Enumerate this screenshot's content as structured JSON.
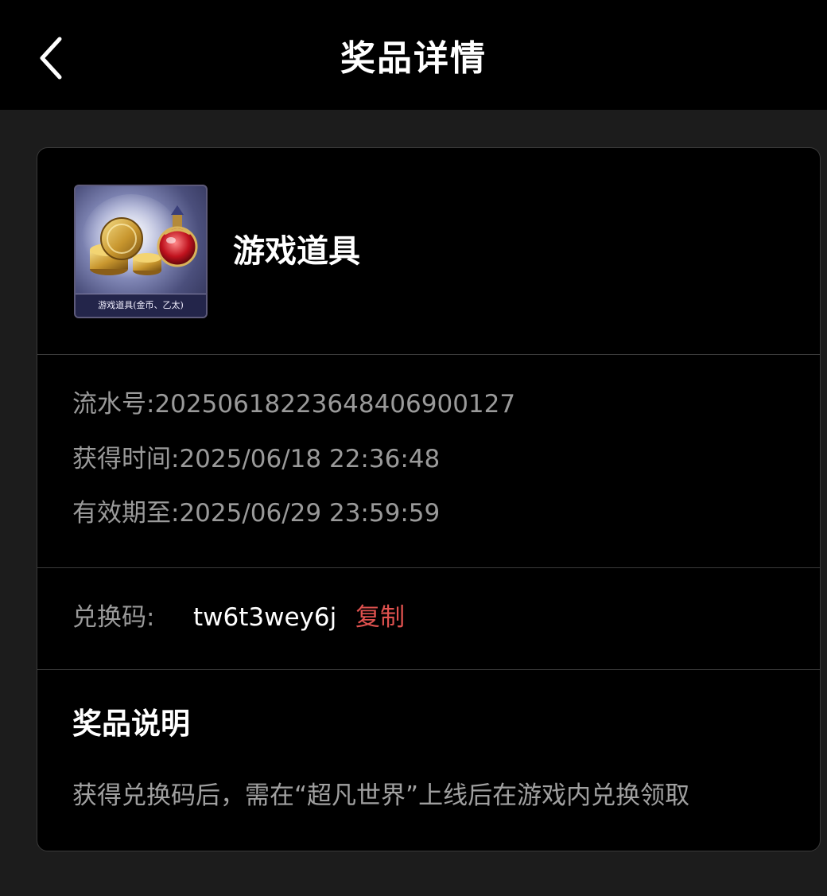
{
  "header": {
    "title": "奖品详情",
    "back_icon": "chevron-left-icon"
  },
  "prize": {
    "image_caption": "游戏道具(金币、乙太)",
    "name": "游戏道具"
  },
  "details": {
    "serial_label": "流水号:",
    "serial_value": "20250618223648406900127",
    "obtained_label": "获得时间:",
    "obtained_value": "2025/06/18 22:36:48",
    "expiry_label": "有效期至:",
    "expiry_value": "2025/06/29 23:59:59"
  },
  "redeem": {
    "label": "兑换码:",
    "code": "tw6t3wey6j",
    "copy_label": "复制"
  },
  "description": {
    "title": "奖品说明",
    "text": "获得兑换码后，需在“超凡世界”上线后在游戏内兑换领取"
  },
  "colors": {
    "background": "#1c1c1c",
    "card": "#000000",
    "accent": "#e0524f",
    "muted_text": "#9a9a9a"
  }
}
